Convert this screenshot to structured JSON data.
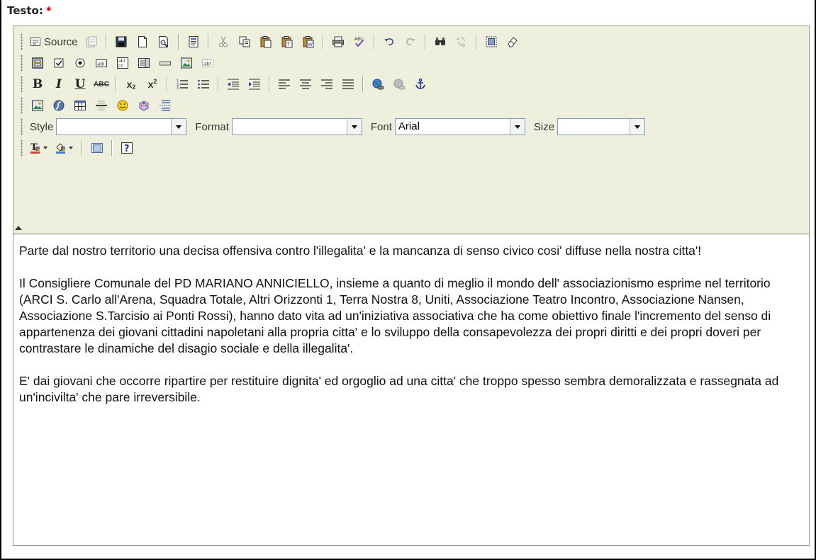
{
  "field": {
    "label": "Testo:",
    "required_mark": "*"
  },
  "toolbar": {
    "source_label": "Source",
    "style_label": "Style",
    "style_value": "",
    "format_label": "Format",
    "format_value": "",
    "font_label": "Font",
    "font_value": "Arial",
    "size_label": "Size",
    "size_value": "",
    "bold_label": "B",
    "italic_label": "I",
    "underline_label": "U",
    "strike_label": "ABC",
    "subscript_label": "x",
    "superscript_label": "x"
  },
  "content": {
    "paragraphs": [
      "Parte dal nostro territorio una decisa offensiva contro l'illegalita' e la mancanza di senso civico cosi' diffuse nella nostra citta'!",
      "Il Consigliere Comunale del PD MARIANO ANNICIELLO, insieme a quanto di meglio il mondo dell' associazionismo esprime nel territorio (ARCI S. Carlo all'Arena, Squadra Totale, Altri Orizzonti 1, Terra Nostra 8, Uniti, Associazione Teatro Incontro, Associazione Nansen, Associazione S.Tarcisio ai Ponti Rossi), hanno dato vita ad un'iniziativa associativa che ha come obiettivo finale l'incremento del senso di appartenenza dei giovani cittadini napoletani alla propria citta' e lo sviluppo della consapevolezza dei propri diritti e dei propri doveri per contrastare le dinamiche del disagio sociale e della illegalita'.",
      "E' dai giovani che occorre ripartire per restituire dignita' ed orgoglio ad una citta' che troppo spesso sembra demoralizzata e rassegnata ad un'incivilta' che pare irreversibile."
    ]
  },
  "colors": {
    "toolbar_bg": "#efefde",
    "required": "#d00000",
    "combo_border": "#7f9db9"
  }
}
